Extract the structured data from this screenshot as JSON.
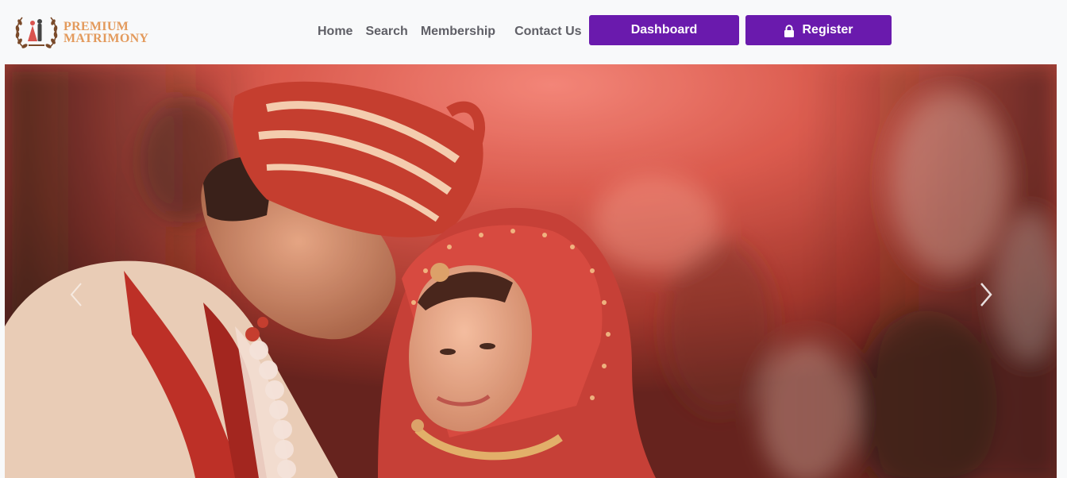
{
  "brand": {
    "line1": "PREMIUM",
    "line2": "MATRIMONY",
    "emblem_icon": "couple-wreath-logo",
    "color": "#e39a5c"
  },
  "nav": {
    "links": [
      {
        "label": "Home"
      },
      {
        "label": "Search"
      },
      {
        "label": "Membership"
      },
      {
        "label": "Contact Us"
      }
    ],
    "dashboard_label": "Dashboard",
    "register_label": "Register",
    "register_icon": "lock-icon",
    "button_color": "#6a1aad"
  },
  "hero": {
    "image_subject": "wedding-couple-photo",
    "prev_icon": "chevron-left-icon",
    "next_icon": "chevron-right-icon"
  }
}
